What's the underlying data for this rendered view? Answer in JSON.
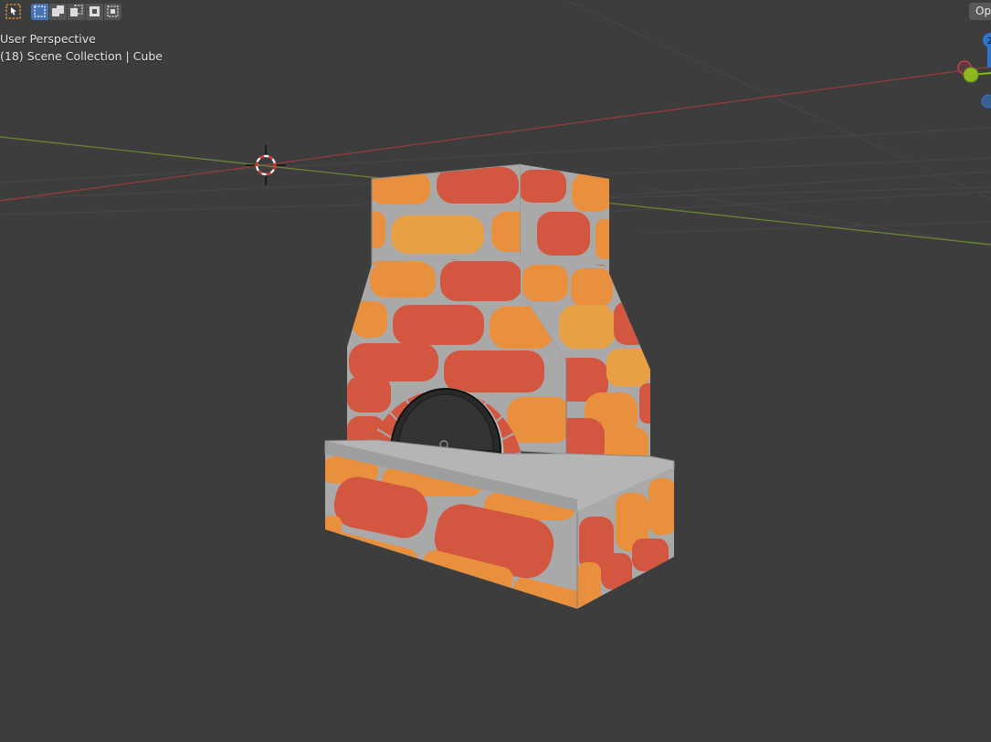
{
  "viewport": {
    "perspective_label": "User Perspective",
    "collection_label": "(18) Scene Collection | Cube"
  },
  "header": {
    "options_label": "Op"
  },
  "toolbar": {
    "tools": [
      "select-cursor-icon"
    ],
    "select_modes": [
      "select-new-icon",
      "select-extend-icon",
      "select-subtract-icon",
      "select-invert-icon",
      "select-intersect-icon"
    ]
  },
  "gizmo": {
    "axes": [
      "Z",
      "X",
      "Y"
    ],
    "colors": {
      "x": "#c0434f",
      "y": "#8bb81f",
      "z": "#2f74c9"
    }
  },
  "colors": {
    "background": "#3d3d3d",
    "x_axis": "#9a3a3f",
    "y_axis": "#6e8a34",
    "accent": "#4772b3",
    "brick_orange": "#e8903e",
    "brick_red": "#d35641",
    "mortar": "#a9a9a9"
  }
}
